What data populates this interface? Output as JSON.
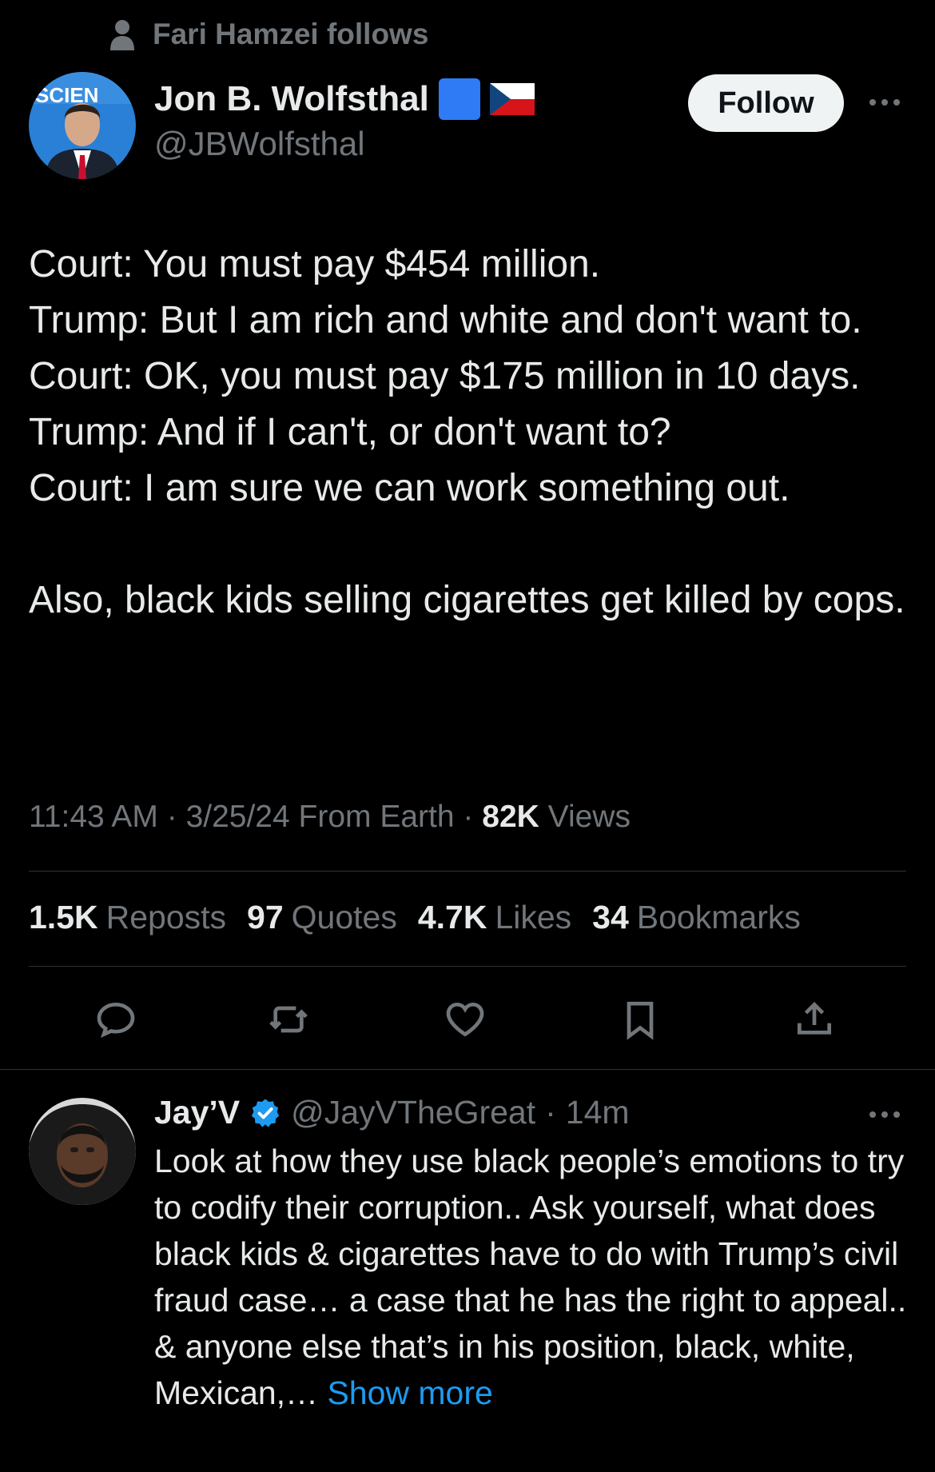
{
  "social_context": {
    "text": "Fari Hamzei follows",
    "icon": "person-icon"
  },
  "tweet": {
    "author_name": "Jon B. Wolfsthal",
    "handle": "@JBWolfsthal",
    "follow_label": "Follow",
    "avatar_sign_text": "SCIEN",
    "flags": [
      "blue-square-emoji",
      "czech-flag-emoji"
    ],
    "lines": [
      "Court: You must pay $454 million.",
      "Trump: But I am rich and white and don't want to.",
      "Court: OK, you must pay $175 million in 10 days.",
      "Trump: And if I can't, or don't want to?",
      "Court: I am sure we can work something out.",
      "",
      "Also, black kids selling cigarettes get killed by cops."
    ],
    "time": "11:43 AM",
    "date": "3/25/24",
    "source": "From Earth",
    "views_count": "82K",
    "views_label": "Views",
    "stats": {
      "reposts_count": "1.5K",
      "reposts_label": "Reposts",
      "quotes_count": "97",
      "quotes_label": "Quotes",
      "likes_count": "4.7K",
      "likes_label": "Likes",
      "bookmarks_count": "34",
      "bookmarks_label": "Bookmarks"
    }
  },
  "reply": {
    "author_name": "Jay’V",
    "handle": "@JayVTheGreat",
    "time": "14m",
    "verified_color": "#1d9bf0",
    "text": "Look at how they use black people’s emotions to try to codify their corruption.. Ask yourself, what does black kids & cigarettes have to do with Trump’s civil fraud case… a case that he has the right to appeal.. & anyone else that’s in his position, black, white, Mexican,… ",
    "show_more": "Show more"
  },
  "colors": {
    "background": "#000000",
    "text": "#e7e9ea",
    "muted": "#71767b",
    "accent": "#1d9bf0",
    "divider": "#2f3336"
  }
}
